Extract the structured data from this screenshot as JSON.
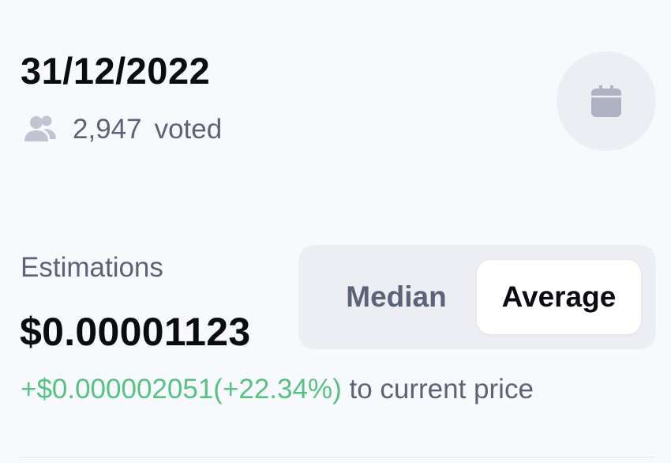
{
  "prediction": {
    "date": "31/12/2022",
    "voted_count": "2,947",
    "voted_label": "voted",
    "calendar_icon": "calendar-icon",
    "people_icon": "people-icon"
  },
  "estimations": {
    "label": "Estimations",
    "value": "$0.00001123",
    "difference": "+$0.000002051(+22.34%)",
    "difference_suffix": " to current price",
    "toggle": {
      "options": [
        "Median",
        "Average"
      ],
      "selected": "Average"
    }
  },
  "colors": {
    "background": "#f8f9fd",
    "text_primary": "#0b0b12",
    "text_secondary": "#5c6378",
    "positive": "#55c381",
    "icon_gray": "#aeb2c2",
    "control_bg": "#eceef3"
  }
}
